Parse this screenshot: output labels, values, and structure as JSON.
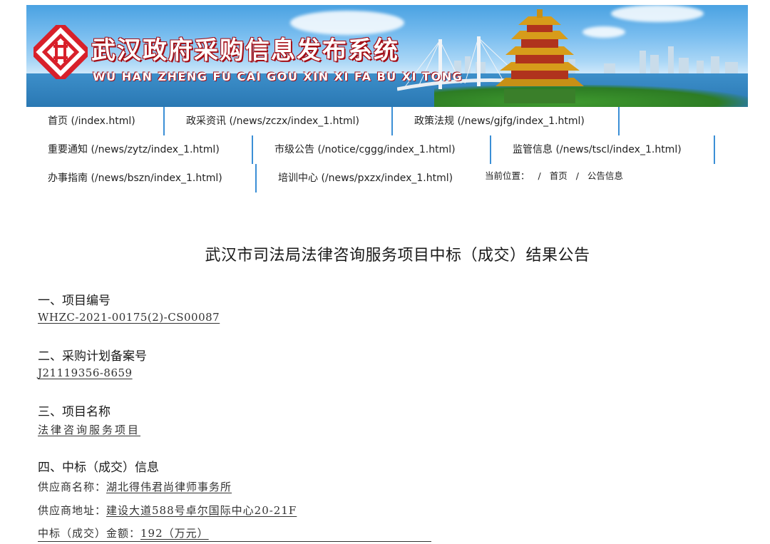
{
  "banner": {
    "title": "武汉政府采购信息发布系统",
    "subtitle": "WU HAN ZHENG FU CAI GOU XIN XI FA BU XI TONG",
    "logo_icon": "procurement-logo-icon",
    "colors": {
      "brand_red": "#d8202a",
      "sky": "#79bdef",
      "river": "#2a78b3"
    }
  },
  "nav": {
    "row1": [
      "首页 (/index.html)",
      "政采资讯 (/news/zczx/index_1.html)",
      "政策法规 (/news/gjfg/index_1.html)"
    ],
    "row2": [
      "重要通知 (/news/zytz/index_1.html)",
      "市级公告 (/notice/cggg/index_1.html)",
      "监管信息 (/news/tscl/index_1.html)"
    ],
    "row3": [
      "办事指南 (/news/bszn/index_1.html)",
      "培训中心 (/news/pxzx/index_1.html)"
    ],
    "divider_color": "#3b8fd6"
  },
  "breadcrumb": {
    "label": "当前位置：",
    "sep": "/",
    "home": "首页",
    "current": "公告信息"
  },
  "notice": {
    "title": "武汉市司法局法律咨询服务项目中标（成交）结果公告",
    "s1_head": "一、项目编号",
    "s1_val": "WHZC-2021-00175(2)-CS00087",
    "s2_head": "二、采购计划备案号",
    "s2_val": "J21119356-8659",
    "s3_head": "三、项目名称",
    "s3_val": "法律咨询服务项目",
    "s4_head": "四、中标（成交）信息",
    "supplier_name_label": "供应商名称：",
    "supplier_name": "湖北得伟君尚律师事务所",
    "supplier_addr_label": "供应商地址：",
    "supplier_addr": "建设大道588号卓尔国际中心20-21F",
    "amount_label": "中标（成交）金额：",
    "amount": "192（万元）"
  }
}
